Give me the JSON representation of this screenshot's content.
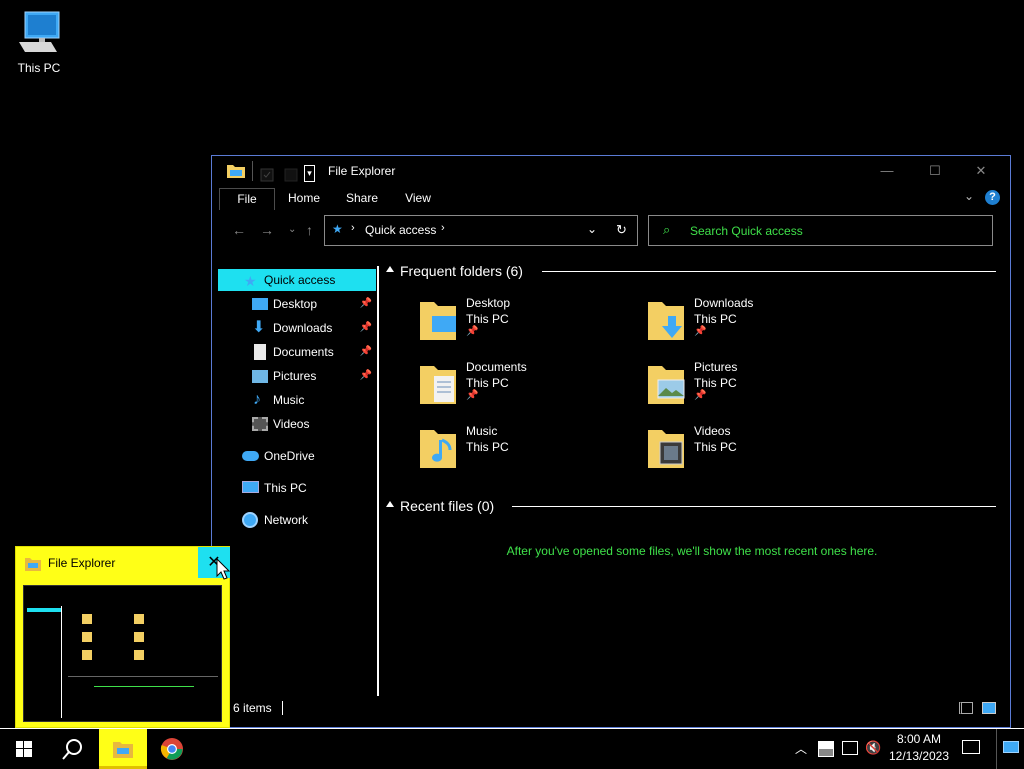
{
  "desktop": {
    "icons": [
      {
        "label": "This PC",
        "icon": "this-pc-icon"
      }
    ]
  },
  "window": {
    "title": "File Explorer",
    "controls": {
      "minimize": "—",
      "maximize": "☐",
      "close": "✕"
    },
    "ribbon_tabs": [
      "File",
      "Home",
      "Share",
      "View"
    ],
    "address": {
      "path": "Quick access"
    },
    "search": {
      "placeholder": "Search Quick access"
    },
    "sidebar": [
      {
        "label": "Quick access",
        "icon": "star-icon",
        "selected": true
      },
      {
        "label": "Desktop",
        "icon": "desktop-icon",
        "pinned": true
      },
      {
        "label": "Downloads",
        "icon": "download-arrow-icon",
        "pinned": true
      },
      {
        "label": "Documents",
        "icon": "document-icon",
        "pinned": true
      },
      {
        "label": "Pictures",
        "icon": "picture-icon",
        "pinned": true
      },
      {
        "label": "Music",
        "icon": "music-note-icon"
      },
      {
        "label": "Videos",
        "icon": "video-icon"
      },
      {
        "label": "OneDrive",
        "icon": "cloud-icon"
      },
      {
        "label": "This PC",
        "icon": "computer-icon"
      },
      {
        "label": "Network",
        "icon": "network-icon"
      }
    ],
    "frequent": {
      "heading": "Frequent folders (6)",
      "folders": [
        {
          "name": "Desktop",
          "location": "This PC",
          "pinned": true
        },
        {
          "name": "Downloads",
          "location": "This PC",
          "pinned": true
        },
        {
          "name": "Documents",
          "location": "This PC",
          "pinned": true
        },
        {
          "name": "Pictures",
          "location": "This PC",
          "pinned": true
        },
        {
          "name": "Music",
          "location": "This PC",
          "pinned": false
        },
        {
          "name": "Videos",
          "location": "This PC",
          "pinned": false
        }
      ]
    },
    "recent": {
      "heading": "Recent files (0)",
      "empty_message": "After you've opened some files, we'll show the most recent ones here."
    },
    "status": {
      "item_count": "6 items"
    }
  },
  "thumbnail": {
    "title": "File Explorer"
  },
  "taskbar": {
    "time": "8:00 AM",
    "date": "12/13/2023"
  },
  "colors": {
    "selection": "#1ee0f0",
    "accent_green": "#3fe04a",
    "thumbnail_bg": "#ffff17",
    "window_border": "#5b7bd5",
    "folder_yellow": "#f3cf63"
  }
}
